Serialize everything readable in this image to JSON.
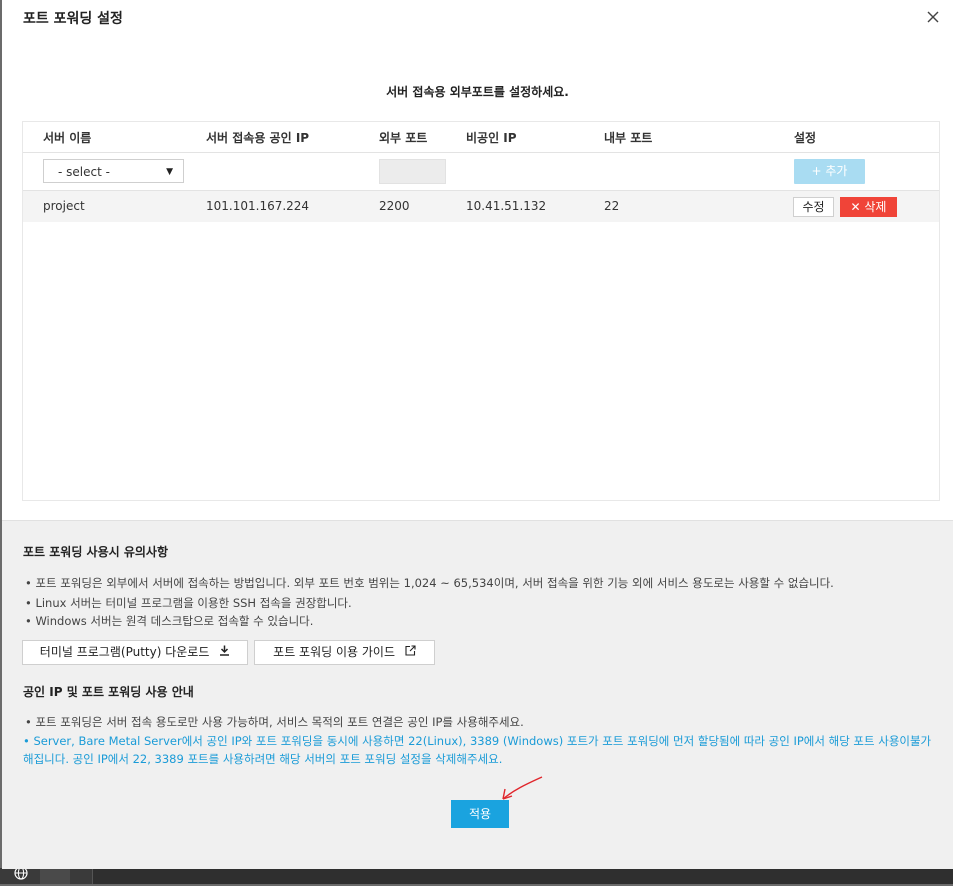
{
  "modal": {
    "title": "포트 포워딩 설정",
    "close_icon": "close-icon",
    "subtitle": "서버 접속용 외부포트를 설정하세요."
  },
  "table": {
    "headers": [
      "서버 이름",
      "서버 접속용 공인 IP",
      "외부 포트",
      "비공인 IP",
      "내부 포트",
      "설정"
    ],
    "select_value": "- select -",
    "add_label": "추가",
    "rows": [
      {
        "server_name": "project",
        "public_ip": "101.101.167.224",
        "external_port": "2200",
        "private_ip": "10.41.51.132",
        "internal_port": "22",
        "edit_label": "수정",
        "delete_label": "삭제"
      }
    ]
  },
  "notes": {
    "title": "포트 포워딩 사용시 유의사항",
    "items": [
      "• 포트 포워딩은 외부에서 서버에 접속하는 방법입니다. 외부 포트 번호 범위는 1,024 ~ 65,534이며, 서버 접속을 위한 기능 외에 서비스 용도로는 사용할 수 없습니다.",
      "• Linux 서버는 터미널 프로그램을 이용한 SSH 접속을 권장합니다.",
      "• Windows 서버는 원격 데스크탑으로 접속할 수 있습니다."
    ],
    "download_label": "터미널 프로그램(Putty) 다운로드",
    "guide_label": "포트 포워딩 이용 가이드"
  },
  "public_ip_guide": {
    "title": "공인 IP 및 포트 포워딩 사용 안내",
    "items": [
      "• 포트 포워딩은 서버 접속 용도로만 사용 가능하며, 서비스 목적의 포트 연결은 공인 IP를 사용해주세요.",
      "• Server, Bare Metal Server에서 공인 IP와 포트 포워딩을 동시에 사용하면 22(Linux), 3389 (Windows) 포트가 포트 포워딩에 먼저 할당됨에 따라 공인 IP에서 해당 포트 사용이불가해집니다. 공인 IP에서 22, 3389 포트를 사용하려면 해당 서버의 포트 포워딩 설정을 삭제해주세요."
    ]
  },
  "apply_label": "적용",
  "colors": {
    "accent": "#1aa3df",
    "add_disabled": "#a9dcf2",
    "danger": "#f04438",
    "info_text": "#1a9bd7",
    "annotation": "#e0262c"
  }
}
